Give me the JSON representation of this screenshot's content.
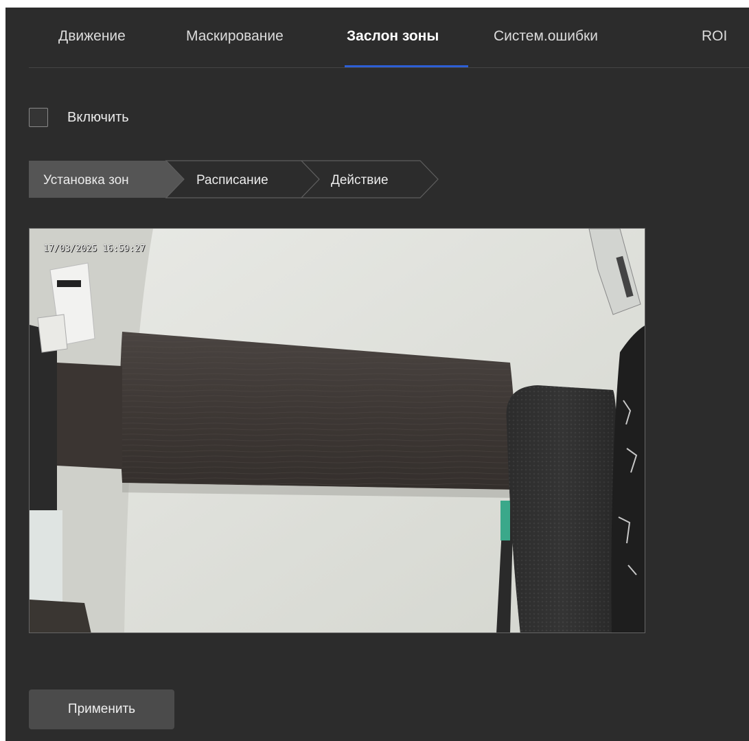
{
  "tabs": [
    {
      "label": "Движение",
      "active": false
    },
    {
      "label": "Маскирование",
      "active": false
    },
    {
      "label": "Заслон зоны",
      "active": true
    },
    {
      "label": "Систем.ошибки",
      "active": false
    },
    {
      "label": "ROI",
      "active": false
    }
  ],
  "enable": {
    "label": "Включить",
    "checked": false
  },
  "steps": [
    {
      "label": "Установка зон",
      "active": true
    },
    {
      "label": "Расписание",
      "active": false
    },
    {
      "label": "Действие",
      "active": false
    }
  ],
  "camera": {
    "timestamp": "17/03/2025 16:59:27"
  },
  "apply_label": "Применить",
  "colors": {
    "background": "#2c2c2c",
    "accent": "#2d5fd6",
    "active_step": "#555555"
  }
}
